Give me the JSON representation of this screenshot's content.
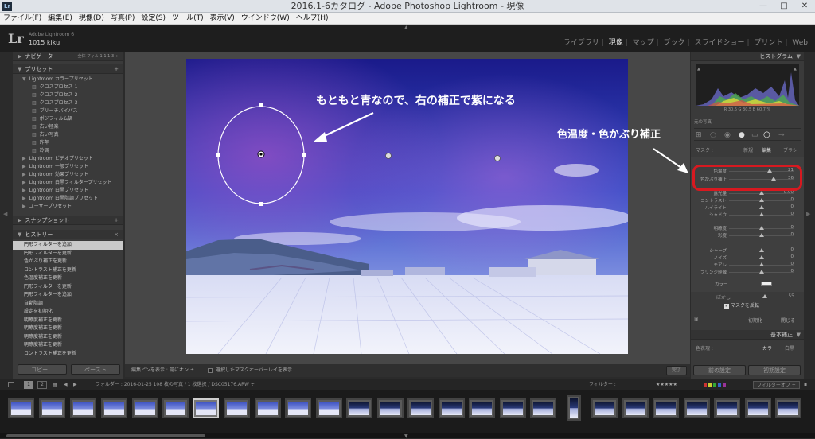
{
  "window": {
    "title": "2016.1-6カタログ - Adobe Photoshop Lightroom - 現像",
    "app_icon": "Lr",
    "minimize": "—",
    "maximize": "□",
    "close": "✕"
  },
  "menu": [
    "ファイル(F)",
    "編集(E)",
    "現像(D)",
    "写真(P)",
    "設定(S)",
    "ツール(T)",
    "表示(V)",
    "ウインドウ(W)",
    "ヘルプ(H)"
  ],
  "identity": {
    "logo": "Lr",
    "version": "Adobe Lightroom 6",
    "user": "1015 kiku"
  },
  "modules": [
    {
      "label": "ライブラリ"
    },
    {
      "label": "現像",
      "active": true
    },
    {
      "label": "マップ"
    },
    {
      "label": "ブック"
    },
    {
      "label": "スライドショー"
    },
    {
      "label": "プリント"
    },
    {
      "label": "Web"
    }
  ],
  "left": {
    "navigator": {
      "label": "ナビゲーター",
      "zoom": "全体  フィル  1:1  1:3 ÷"
    },
    "presets": {
      "label": "プリセット",
      "add": "+",
      "items": [
        {
          "label": "Lightroom カラープリセット",
          "level": 0,
          "open": true
        },
        {
          "label": "クロスプロセス 1",
          "level": 1
        },
        {
          "label": "クロスプロセス 2",
          "level": 1
        },
        {
          "label": "クロスプロセス 3",
          "level": 1
        },
        {
          "label": "ブリーチバイパス",
          "level": 1
        },
        {
          "label": "ポジフィルム調",
          "level": 1
        },
        {
          "label": "古い極楽",
          "level": 1
        },
        {
          "label": "古い写真",
          "level": 1
        },
        {
          "label": "昨年",
          "level": 1
        },
        {
          "label": "冷調",
          "level": 1
        },
        {
          "label": "Lightroom ビデオプリセット",
          "level": 0
        },
        {
          "label": "Lightroom 一般プリセット",
          "level": 0
        },
        {
          "label": "Lightroom 効果プリセット",
          "level": 0
        },
        {
          "label": "Lightroom 白黒フィルタープリセット",
          "level": 0
        },
        {
          "label": "Lightroom 白黒プリセット",
          "level": 0
        },
        {
          "label": "Lightroom 白黒階調プリセット",
          "level": 0
        },
        {
          "label": "ユーザープリセット",
          "level": 0
        }
      ]
    },
    "snapshot": {
      "label": "スナップショット",
      "add": "+"
    },
    "history": {
      "label": "ヒストリー",
      "close": "×",
      "items": [
        "円形フィルターを追加",
        "円形フィルターを更新",
        "色かぶり補正を更新",
        "コントラスト補正を更新",
        "色温度補正を更新",
        "円形フィルターを更新",
        "円形フィルターを追加",
        "自動階調",
        "設定を初期化",
        "明瞭度補正を更新",
        "明瞭度補正を更新",
        "明瞭度補正を更新",
        "明瞭度補正を更新",
        "コントラスト補正を更新"
      ]
    },
    "copy_button": "コピー...",
    "paste_button": "ペースト"
  },
  "annotations": {
    "main": "もともと青なので、右の補正で紫になる",
    "right": "色温度・色かぶり補正"
  },
  "toolbar": {
    "show_pins_label": "編集ピンを表示 :",
    "show_pins_value": "常にオン ÷",
    "overlay_label": "選択したマスクオーバーレイを表示",
    "done": "完了"
  },
  "right": {
    "histogram": {
      "label": "ヒストグラム",
      "stats": "R  30.6   G  30.5   B  60.7 %",
      "original": "元の写真"
    },
    "mask": {
      "label": "マスク :",
      "new": "新規",
      "edit": "編集",
      "brush": "ブラシ"
    },
    "sliders": [
      {
        "label": "色温度",
        "value": "21",
        "pos": 0.62
      },
      {
        "label": "色かぶり補正",
        "value": "36",
        "pos": 0.68
      },
      {
        "label": "露光量",
        "value": "0.00",
        "pos": 0.5
      },
      {
        "label": "コントラスト",
        "value": "0",
        "pos": 0.5
      },
      {
        "label": "ハイライト",
        "value": "0",
        "pos": 0.5
      },
      {
        "label": "シャドウ",
        "value": "0",
        "pos": 0.5
      },
      {
        "label": "明瞭度",
        "value": "0",
        "pos": 0.5
      },
      {
        "label": "彩度",
        "value": "0",
        "pos": 0.5
      },
      {
        "label": "シャープ",
        "value": "0",
        "pos": 0.5
      },
      {
        "label": "ノイズ",
        "value": "0",
        "pos": 0.5
      },
      {
        "label": "モアレ",
        "value": "0",
        "pos": 0.5
      },
      {
        "label": "フリンジ軽減",
        "value": "0",
        "pos": 0.5
      }
    ],
    "color_label": "カラー",
    "feather_label": "ぼかし",
    "feather_value": "55",
    "invert_label": "マスクを反転",
    "reset_label": "初期化",
    "close_label": "閉じる",
    "basic_label": "基本補正",
    "treatment_label": "色表現 :",
    "treatment_color": "カラー",
    "treatment_bw": "白黒",
    "prev_button": "前の設定",
    "reset_button": "初期設定"
  },
  "filmstrip": {
    "page1": "1",
    "page2": "2",
    "path": "フォルダー : 2016-01-25   108 枚の写真 / 1 枚選択 / DSC05176.ARW ÷",
    "filter_label": "フィルター :",
    "filter_off": "フィルターオフ ÷",
    "stars": "★★★★★"
  },
  "colors": {
    "accent_red": "#d71920",
    "annotation": "#ffffff"
  }
}
